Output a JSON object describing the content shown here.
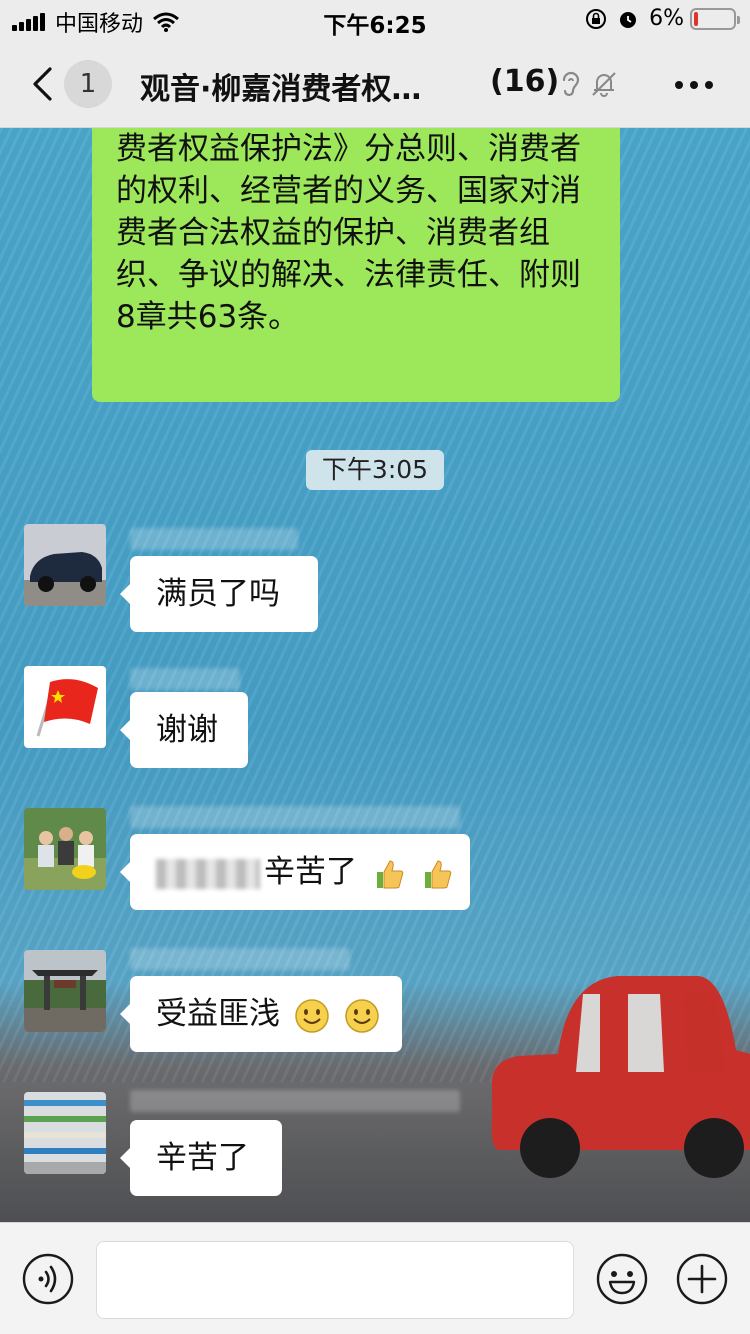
{
  "status_bar": {
    "carrier": "中国移动",
    "time": "下午6:25",
    "battery": "6%"
  },
  "nav": {
    "unread_count": "1",
    "title": "观音·柳嘉消费者权…",
    "member_count": "(16)"
  },
  "messages": {
    "my_text": "费者权益保护法》分总则、消费者的权利、经营者的义务、国家对消费者合法权益的保护、消费者组织、争议的解决、法律责任、附则8章共63条。",
    "time_divider": "下午3:05",
    "m1": "满员了吗",
    "m2": "谢谢",
    "m3": "辛苦了",
    "m4": "受益匪浅",
    "m5": "辛苦了"
  },
  "input": {
    "value": ""
  },
  "colors": {
    "my_bubble": "#9de75a",
    "chat_bg": "#4a9fc4",
    "battery_low": "#e0332c"
  }
}
